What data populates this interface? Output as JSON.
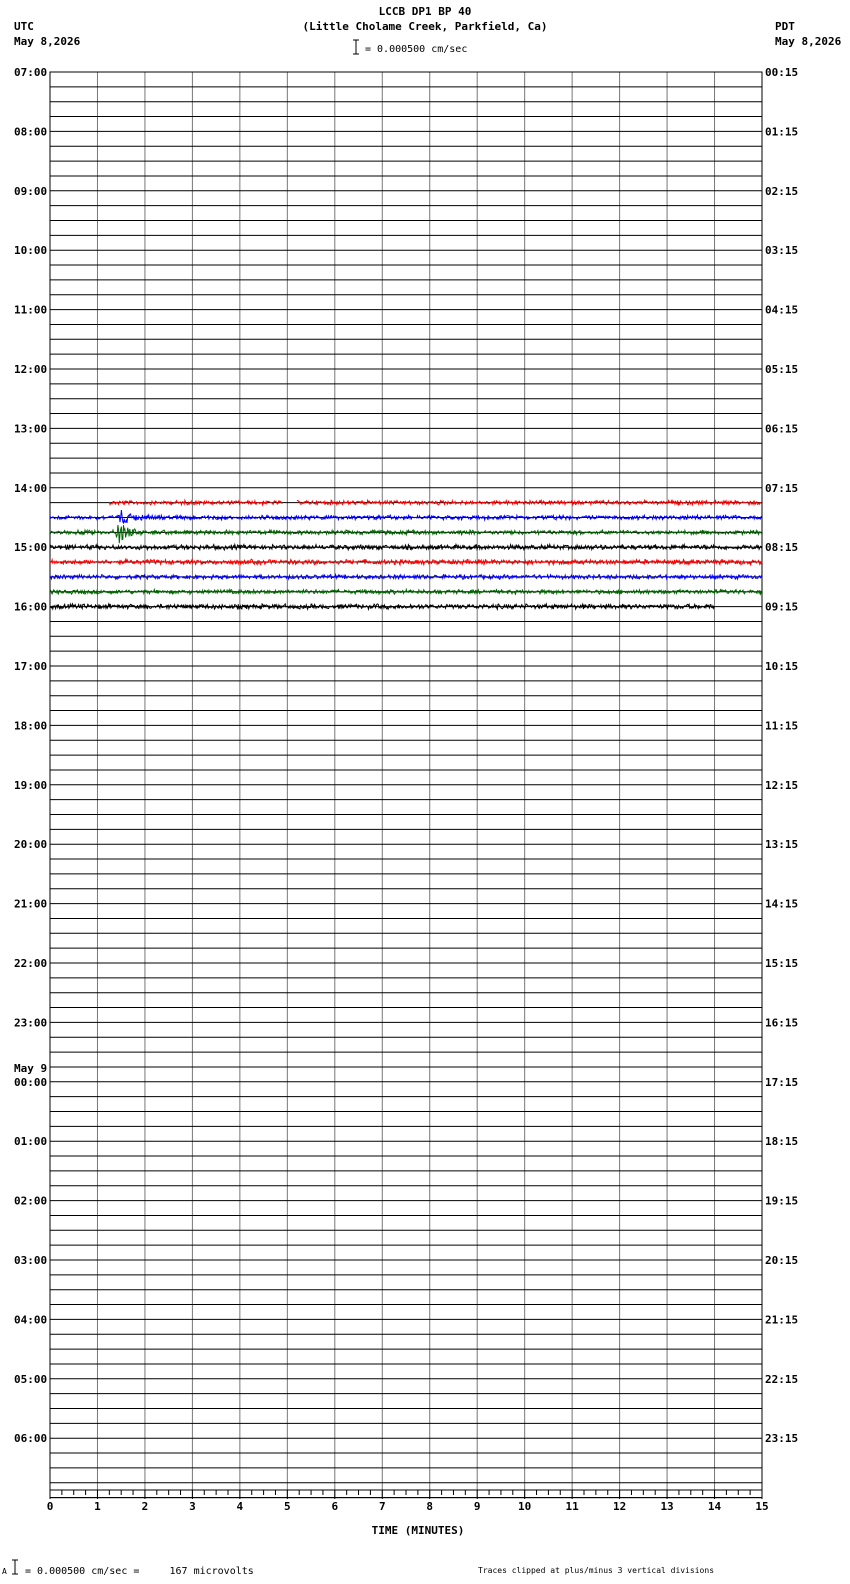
{
  "header": {
    "title": "LCCB DP1 BP 40",
    "subtitle": "(Little Cholame Creek, Parkfield, Ca)",
    "scale_label": "= 0.000500 cm/sec",
    "left_tz": "UTC",
    "left_date": "May 8,2026",
    "right_tz": "PDT",
    "right_date": "May 8,2026"
  },
  "footer": {
    "scale_note": "= 0.000500 cm/sec =     167 microvolts",
    "clip_note": "Traces clipped at plus/minus 3 vertical divisions",
    "corner_mark": "A"
  },
  "chart_data": {
    "type": "line",
    "xlabel": "TIME (MINUTES)",
    "xlim": [
      0,
      15
    ],
    "x_ticks": [
      "0",
      "1",
      "2",
      "3",
      "4",
      "5",
      "6",
      "7",
      "8",
      "9",
      "10",
      "11",
      "12",
      "13",
      "14",
      "15"
    ],
    "left_labels": [
      "07:00",
      "08:00",
      "09:00",
      "10:00",
      "11:00",
      "12:00",
      "13:00",
      "14:00",
      "15:00",
      "16:00",
      "17:00",
      "18:00",
      "19:00",
      "20:00",
      "21:00",
      "22:00",
      "23:00",
      "00:00",
      "01:00",
      "02:00",
      "03:00",
      "04:00",
      "05:00",
      "06:00"
    ],
    "date_change_label": "May 9",
    "date_change_index": 17,
    "right_labels": [
      "00:15",
      "01:15",
      "02:15",
      "03:15",
      "04:15",
      "05:15",
      "06:15",
      "07:15",
      "08:15",
      "09:15",
      "10:15",
      "11:15",
      "12:15",
      "13:15",
      "14:15",
      "15:15",
      "16:15",
      "17:15",
      "18:15",
      "19:15",
      "20:15",
      "21:15",
      "22:15",
      "23:15"
    ],
    "rows_total": 96,
    "rows_per_hour": 4,
    "trace_colors": [
      "#000000",
      "#ff0000",
      "#0000ff",
      "#006400"
    ],
    "traces": [
      {
        "row": 29,
        "color": "#ff0000",
        "x_start": 1.25,
        "x_end": 15,
        "amp": 0.12,
        "gap": [
          4.9,
          5.2
        ]
      },
      {
        "row": 30,
        "color": "#0000ff",
        "x_start": 0,
        "x_end": 15,
        "amp": 0.12,
        "event_x": 1.45,
        "event_amp": 0.8
      },
      {
        "row": 31,
        "color": "#006400",
        "x_start": 0,
        "x_end": 15,
        "amp": 0.12,
        "event_x": 1.4,
        "event_amp": 1.3
      },
      {
        "row": 32,
        "color": "#000000",
        "x_start": 0,
        "x_end": 15,
        "amp": 0.14
      },
      {
        "row": 33,
        "color": "#ff0000",
        "x_start": 0,
        "x_end": 15,
        "amp": 0.14
      },
      {
        "row": 34,
        "color": "#0000ff",
        "x_start": 0,
        "x_end": 15,
        "amp": 0.12
      },
      {
        "row": 35,
        "color": "#006400",
        "x_start": 0,
        "x_end": 15,
        "amp": 0.12
      },
      {
        "row": 36,
        "color": "#000000",
        "x_start": 0,
        "x_end": 14,
        "amp": 0.14
      }
    ]
  }
}
